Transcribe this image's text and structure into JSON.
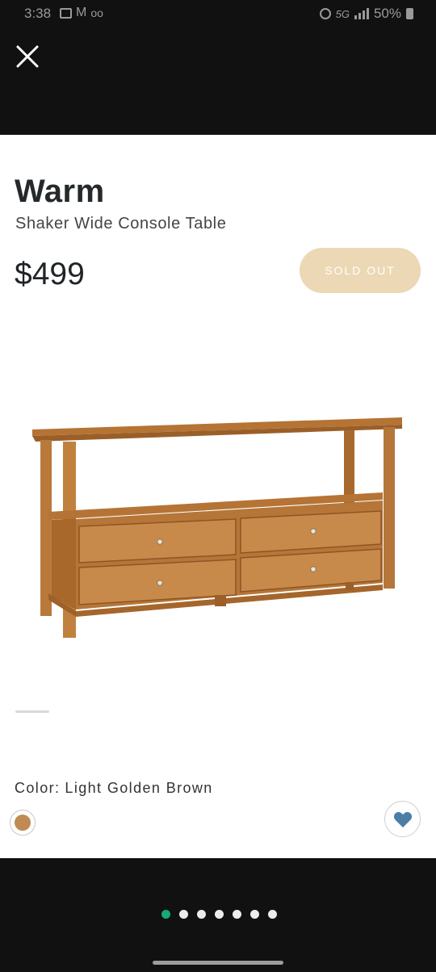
{
  "status_bar": {
    "time": "3:38",
    "network": "5G",
    "battery": "50%"
  },
  "product": {
    "brand": "Warm",
    "name": "Shaker Wide Console Table",
    "price": "$499",
    "availability_button": "SOLD OUT",
    "color_label": "Color:",
    "color_value": "Light Golden Brown",
    "swatch_color": "#c08a52"
  },
  "colors": {
    "sold_out_bg": "#ecd8b4",
    "heart": "#4b7ea6",
    "active_dot": "#17a87c",
    "inactive_dot": "#ececec"
  },
  "pager": {
    "total": 7,
    "active_index": 0
  },
  "icons": {
    "close": "close-icon",
    "favorite": "heart-icon"
  }
}
